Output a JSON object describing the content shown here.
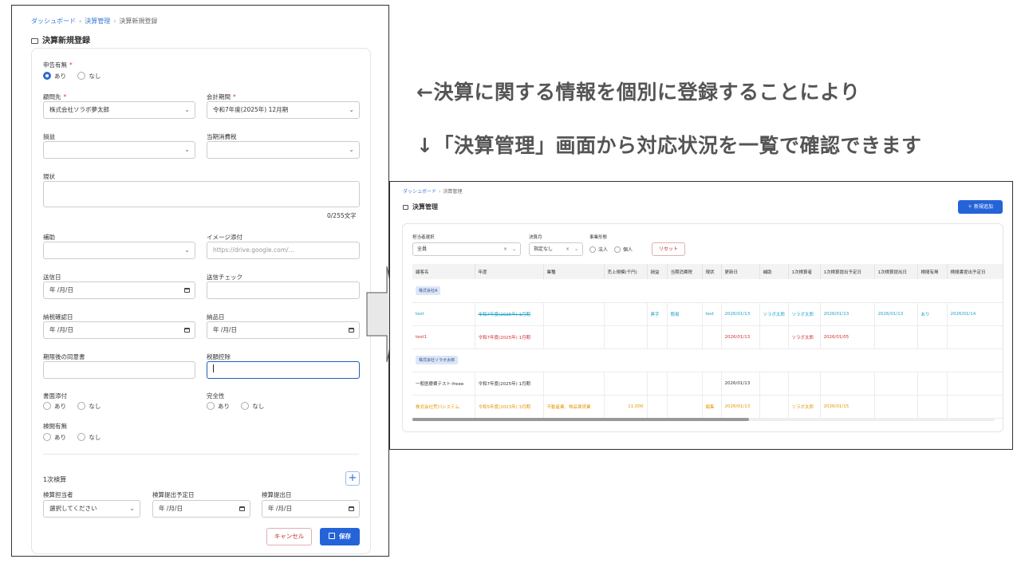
{
  "captions": {
    "line1": "←決算に関する情報を個別に登録することにより",
    "line2": "↓「決算管理」画面から対応状況を一覧で確認できます"
  },
  "form": {
    "breadcrumb": [
      "ダッシュボード",
      "決算管理",
      "決算新規登録"
    ],
    "title": "決算新規登録",
    "shinkoku": {
      "label": "申告有無",
      "options": [
        "あり",
        "なし"
      ],
      "selected": "あり"
    },
    "client": {
      "label": "顧問先",
      "value": "株式会社ソラボ夢太郎"
    },
    "period": {
      "label": "会計期間",
      "value": "令和7年度(2025年) 12月期"
    },
    "soneki": {
      "label": "損益",
      "value": ""
    },
    "shohizei": {
      "label": "当期消費税",
      "value": ""
    },
    "genjo": {
      "label": "現状",
      "counter": "0/255文字"
    },
    "hojo": {
      "label": "補助",
      "value": ""
    },
    "image": {
      "label": "イメージ添付",
      "placeholder": "https://drive.google.com/..."
    },
    "soshin_date": {
      "label": "送信日",
      "value": "年 /月/日"
    },
    "soshin_check": {
      "label": "送信チェック",
      "value": ""
    },
    "nozei_date": {
      "label": "納税確認日",
      "value": "年 /月/日"
    },
    "nohin_date": {
      "label": "納品日",
      "value": "年 /月/日"
    },
    "kigengo": {
      "label": "期限後の同意書",
      "value": ""
    },
    "zeigaku": {
      "label": "税額控除",
      "value": ""
    },
    "shomen": {
      "label": "書面添付",
      "options": [
        "あり",
        "なし"
      ]
    },
    "kanzen": {
      "label": "完全性",
      "options": [
        "あり",
        "なし"
      ]
    },
    "kenetsu": {
      "label": "検閲有無",
      "options": [
        "あり",
        "なし"
      ]
    },
    "kensan": {
      "title": "1次検算",
      "tanto_label": "検算担当者",
      "tanto_value": "選択してください",
      "yotei_label": "検算提出予定日",
      "yotei_value": "年 /月/日",
      "teishutsu_label": "検算提出日",
      "teishutsu_value": "年 /月/日"
    },
    "cancel_label": "キャンセル",
    "save_label": "保存"
  },
  "list": {
    "breadcrumb": [
      "ダッシュボード",
      "決算管理"
    ],
    "title": "決算管理",
    "new_button": "新規追加",
    "filters": {
      "tanto_label": "担当者選択",
      "tanto_value": "全員",
      "kessanzuki_label": "決算月",
      "kessanzuki_value": "指定なし",
      "jigyo_label": "事業形態",
      "jigyo_options": [
        "法人",
        "個人"
      ],
      "reset_label": "リセット"
    },
    "columns": [
      "顧客名",
      "年度",
      "業種",
      "売上規模(千円)",
      "損益",
      "当期消費税",
      "現状",
      "更新日",
      "補助",
      "1次検算者",
      "1次検算提出予定日",
      "1次検算提出日",
      "検閲有無",
      "検閲書提出予定日"
    ],
    "groups": [
      {
        "name": "株式会社A",
        "rows": [
          {
            "style": "cyan",
            "cells": [
              "test",
              "令和7年度(2025年) 1月期",
              "",
              "",
              "黒字",
              "簡易",
              "test",
              "2026/01/13",
              "ソラボ太郎",
              "ソラボ太郎",
              "2026/01/13",
              "2026/01/13",
              "あり",
              "2026/01/14"
            ]
          },
          {
            "style": "red",
            "cells": [
              "test1",
              "令和7年度(2025年) 1月期",
              "",
              "",
              "",
              "",
              "",
              "2026/01/13",
              "",
              "ソラボ太郎",
              "2026/01/05",
              "",
              "",
              ""
            ]
          }
        ]
      },
      {
        "name": "株式会社ソラボ太郎",
        "rows": [
          {
            "style": "plain",
            "cells": [
              "一般医療費テスト-freee",
              "令和7年度(2025年) 1月期",
              "",
              "",
              "",
              "",
              "",
              "2026/01/13",
              "",
              "",
              "",
              "",
              "",
              ""
            ]
          },
          {
            "style": "orange",
            "cells": [
              "株式会社荒川システム",
              "令和5年度(2023年) 3月期",
              "不動産業、物品賃貸業",
              "11,000",
              "",
              "",
              "編集",
              "2026/01/13",
              "",
              "ソラボ太郎",
              "2026/01/15",
              "",
              "",
              ""
            ]
          }
        ]
      }
    ]
  }
}
